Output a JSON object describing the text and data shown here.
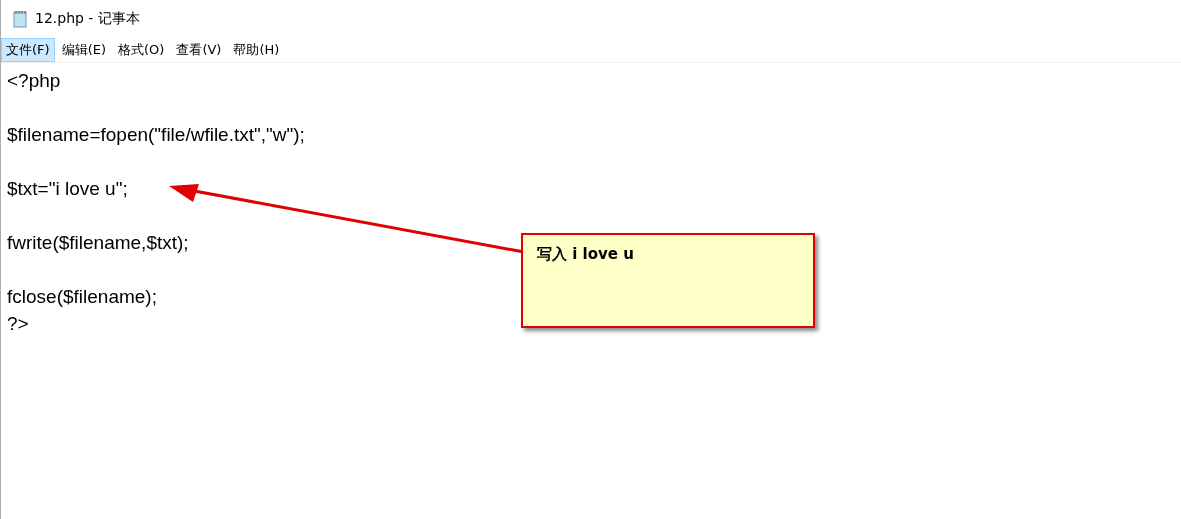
{
  "window": {
    "title": "12.php - 记事本"
  },
  "menu": [
    {
      "label": "文件(F)",
      "selected": true
    },
    {
      "label": "编辑(E)",
      "selected": false
    },
    {
      "label": "格式(O)",
      "selected": false
    },
    {
      "label": "查看(V)",
      "selected": false
    },
    {
      "label": "帮助(H)",
      "selected": false
    }
  ],
  "editor": {
    "blocks": [
      {
        "lines": [
          "<?php"
        ]
      },
      {
        "lines": [
          "$filename=fopen(\"file/wfile.txt\",\"w\");"
        ]
      },
      {
        "lines": [
          "$txt=\"i love u\";"
        ]
      },
      {
        "lines": [
          "fwrite($filename,$txt);"
        ]
      },
      {
        "lines": [
          "fclose($filename);",
          "?>"
        ]
      }
    ]
  },
  "callout": {
    "text": "写入 i love u"
  }
}
